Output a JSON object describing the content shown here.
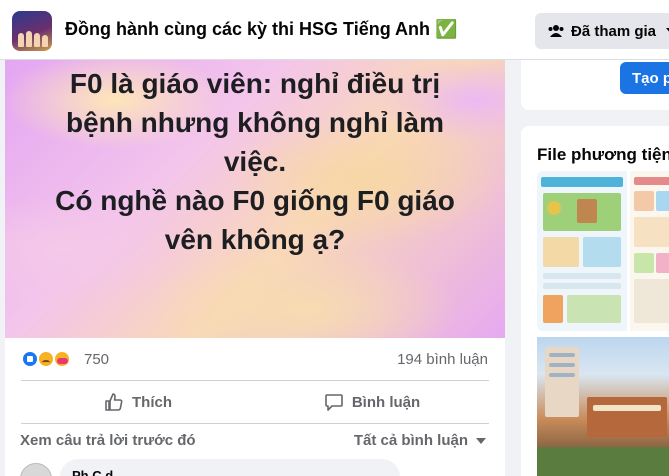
{
  "header": {
    "group_title": "Đồng hành cùng các kỳ thi HSG Tiếng Anh ✅",
    "joined_label": "Đã tham gia",
    "icons": {
      "members": "people-icon",
      "dropdown": "chevron-down-icon"
    }
  },
  "post": {
    "banner_text": "F0 là giáo viên: nghỉ điều trị\nbệnh nhưng không nghỉ làm\nviệc.\nCó nghề nào F0 giống F0 giáo\nvên không ạ?",
    "reaction_count": "750",
    "reaction_types": [
      "like",
      "sad",
      "care"
    ],
    "comment_count": "194 bình luận",
    "actions": {
      "like_label": "Thích",
      "comment_label": "Bình luận"
    },
    "view_previous": "Xem câu trả lời trước đó",
    "sort_label": "Tất cả bình luận",
    "comment_author": "Ph     C   d"
  },
  "sidebar": {
    "create_label": "Tạo p",
    "media_title": "File phương tiện"
  },
  "colors": {
    "primary_blue": "#1b74e4",
    "secondary_text": "#65676b",
    "page_bg": "#f0f2f5"
  }
}
